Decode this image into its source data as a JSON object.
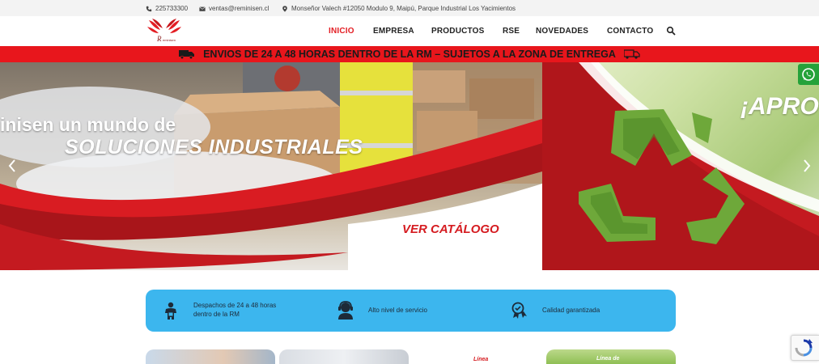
{
  "topbar": {
    "phone": "225733300",
    "email": "ventas@reminisen.cl",
    "address": "Monseñor Valech #12050 Modulo 9, Maipú, Parque Industrial Los Yacimientos"
  },
  "nav": {
    "items": [
      "INICIO",
      "EMPRESA",
      "PRODUCTOS",
      "RSE",
      "NOVEDADES",
      "CONTACTO"
    ],
    "active": "INICIO"
  },
  "banner": {
    "text": "ENVIOS DE 24 A 48 HORAS DENTRO DE LA RM – SUJETOS A LA ZONA DE ENTREGA"
  },
  "hero": {
    "title_line1": "inisen un mundo de",
    "title_line2": "SOLUCIONES INDUSTRIALES",
    "cta": "VER CATÁLOGO",
    "next_slide_title": "¡APRO"
  },
  "features": [
    {
      "icon": "delivery-person-icon",
      "text_line1": "Despachos de 24 a 48 horas",
      "text_line2": "dentro de la RM"
    },
    {
      "icon": "customer-service-icon",
      "text_line1": "Alto nivel de servicio",
      "text_line2": ""
    },
    {
      "icon": "quality-award-icon",
      "text_line1": "Calidad garantizada",
      "text_line2": ""
    }
  ],
  "cards": {
    "labels": [
      "",
      "",
      "Línea",
      "Línea de"
    ]
  },
  "colors": {
    "brand_red": "#e8161c",
    "feature_blue": "#3cb6ee",
    "whatsapp_green": "#25a23a"
  }
}
